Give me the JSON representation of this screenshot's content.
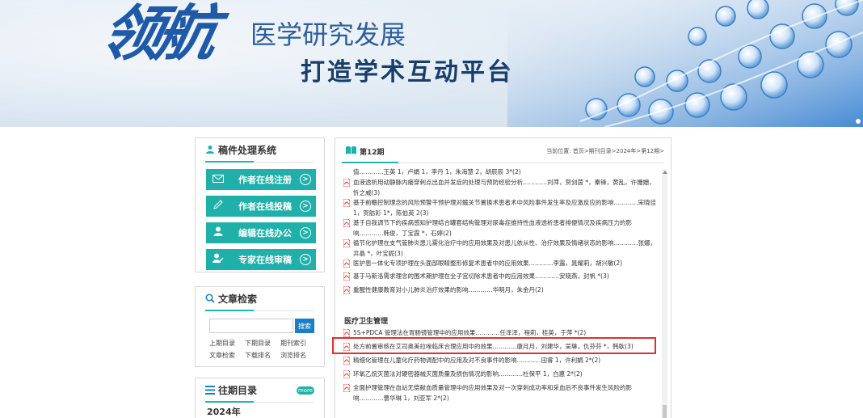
{
  "banner": {
    "logo_text": "领航",
    "tagline_line1": "医学研究发展",
    "tagline_line2": "打造学术互动平台"
  },
  "manuscript_system": {
    "title": "稿件处理系统",
    "buttons": [
      {
        "label": "作者在线注册",
        "icon": "envelope-icon"
      },
      {
        "label": "作者在线投稿",
        "icon": "pencil-icon"
      },
      {
        "label": "编辑在线办公",
        "icon": "user-icon"
      },
      {
        "label": "专家在线审稿",
        "icon": "user-pen-icon"
      }
    ]
  },
  "article_search": {
    "title": "文章检索",
    "input_value": "",
    "search_button": "搜索",
    "links": [
      "上期目录",
      "下期目录",
      "期刊索引",
      "文章检索",
      "下载排名",
      "浏览排名"
    ]
  },
  "archive": {
    "title": "往期目录",
    "more_label": "more",
    "year": "2024年"
  },
  "issue": {
    "title": "第12期",
    "breadcrumb": "当前位置:  首页>期刊目录>2024年>第12期>"
  },
  "articles_top": [
    "值…………王英 1，卢娟 1，李丹 1，朱海慧 2，胡辰辰 3*(2)",
    "血液透析用动静脉内瘘穿刺点出血并发症的处理与预防经验分析…………刘萍，贺剑茵 *，秦锋，黄乱，许姗姗，忻之威(3)",
    "基于前瞻控制理念的风险预警干预护理对髋关节置换术患者术中风险事件发生率及应激反应的影响…………宋晓佳 1，贺舫彩 1*，陈伯英 2(3)",
    "基于自我调节下的疾病感知护理结合罐套结构管理对尿毒症维持性血液透析患者排便情况及疾病压力的影响…………韩俊，丁宝霞 *，石婷(2)",
    "循节化护理在支气管肺炎患儿雾化治疗中的应用效果及对患儿依从性、治疗效果及情绪状态的影响…………张娜，井晶 *，叶宝妮(3)",
    "医护患一体化专项护理在头面部眼睛整形修复术患者中的应用效果…………李露，晁耀莉，胡兴敏(2)",
    "基于马斯洛需求理念的围术期护理在全子宫切除术患者中的应用效果…………安晓燕，封帆 *(3)",
    "重醒性健康教育对小儿肺炎治疗效果的影响…………华明月，朱金丹(2)"
  ],
  "section_title": "医疗卫生管理",
  "articles_bottom": [
    "5S+PDCA 管理法在胃肠镜管理中的应用效果…………任泽泽，程莉，桂英，于萍 *(2)",
    "处方前置审核在艾司奥美拉唑临床合理应用中的效果…………康月月，刘建华，吴琳，仇芬芬 *，韩耿(3)",
    "精细化管理在儿童化疗药物调配中的应用及对不良事件的影响…………田睿 1，许利娟 2*(2)",
    "环氧乙烷灭菌法对硬密器械灭菌质量及损伤情况的影响…………杜保平 1，白惠 2*(2)",
    "全面护理管理在血站无偿献血质量管理中的应用效果及对一次穿刺成功率和采血后不良事件发生风险的影响…………曹华琳 1，刘亚军 2*(2)"
  ]
}
